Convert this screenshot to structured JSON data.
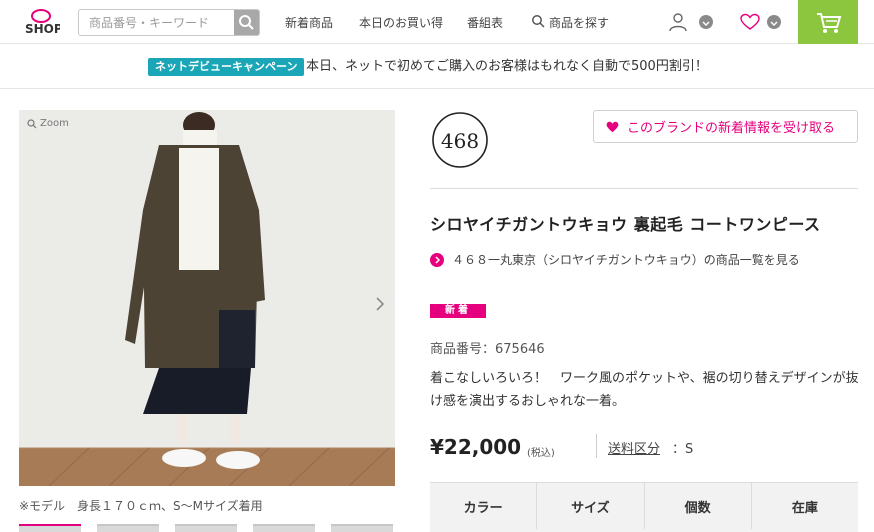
{
  "header": {
    "logo_text": "SHOP",
    "search_placeholder": "商品番号・キーワード",
    "nav": [
      "新着商品",
      "本日のお買い得",
      "番組表",
      "商品を探す"
    ],
    "colors": {
      "cart": "#8cc63f",
      "accent": "#e6007e"
    }
  },
  "campaign": {
    "badge": "ネットデビューキャンペーン",
    "text": "本日、ネットで初めてご購入のお客様はもれなく自動で500円割引！"
  },
  "gallery": {
    "zoom_label": "Zoom",
    "caption": "※モデル　身長１７０ｃｍ、S～Mサイズ着用"
  },
  "product": {
    "brand_logo": "468",
    "follow_label": "このブランドの新着情報を受け取る",
    "title": "シロヤイチガントウキョウ 裏起毛 コートワンピース",
    "brand_link": "４６８一丸東京（シロヤイチガントウキョウ）の商品一覧を見る",
    "new_badge": "新着",
    "product_no": "商品番号：675646",
    "description": "着こなしいろいろ！　ワーク風のポケットや、裾の切り替えデザインが抜け感を演出するおしゃれな一着。",
    "price": "¥22,000",
    "tax_label": "(税込)",
    "shipping_label": "送料区分",
    "shipping_value": "：S"
  },
  "table": {
    "headers": [
      "カラー",
      "サイズ",
      "個数",
      "在庫"
    ]
  }
}
